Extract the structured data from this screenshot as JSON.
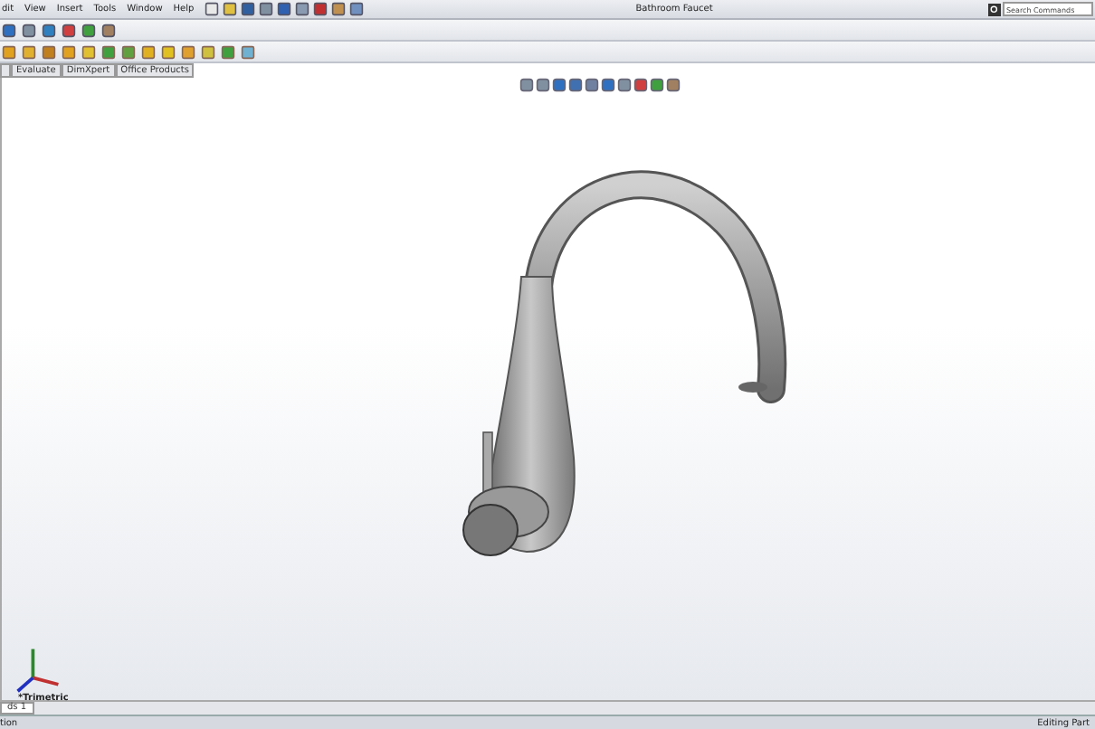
{
  "menu_bar": {
    "items": [
      "dit",
      "View",
      "Insert",
      "Tools",
      "Window",
      "Help"
    ],
    "title": "Bathroom Faucet",
    "search": {
      "placeholder": "Search Commands"
    }
  },
  "command_tabs": [
    {
      "label": "Evaluate",
      "selected": false
    },
    {
      "label": "DimXpert",
      "selected": false
    },
    {
      "label": "Office Products",
      "selected": false
    }
  ],
  "viewport": {
    "view_label": "*Trimetric"
  },
  "model_tabs": [
    {
      "label": "ds 1",
      "selected": true
    }
  ],
  "status_bar": {
    "left": "tion",
    "right": "Editing Part"
  }
}
